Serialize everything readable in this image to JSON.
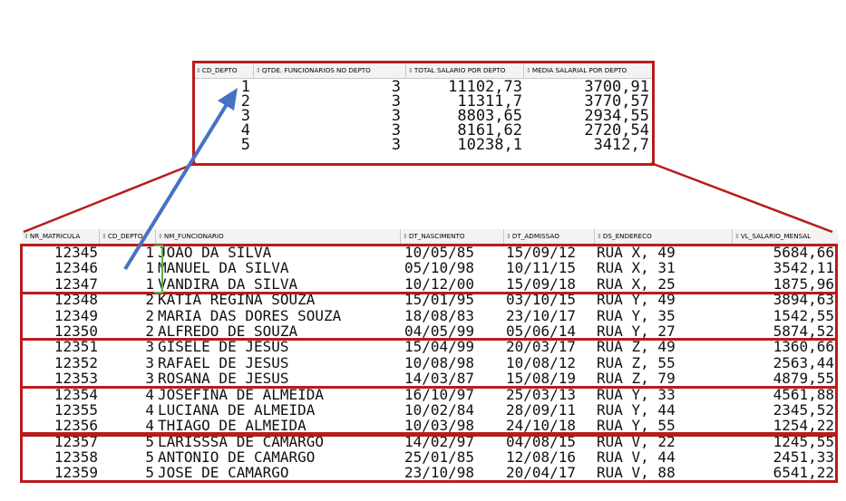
{
  "summary": {
    "headers": [
      "CD_DEPTO",
      "QTDE. FUNCIONARIOS NO DEPTO",
      "TOTAL SALARIO POR DEPTO",
      "MEDIA SALARIAL POR DEPTO"
    ],
    "rows": [
      [
        "1",
        "3",
        "11102,73",
        "3700,91"
      ],
      [
        "2",
        "3",
        "11311,7",
        "3770,57"
      ],
      [
        "3",
        "3",
        "8803,65",
        "2934,55"
      ],
      [
        "4",
        "3",
        "8161,62",
        "2720,54"
      ],
      [
        "5",
        "3",
        "10238,1",
        "3412,7"
      ]
    ]
  },
  "employees": {
    "headers": [
      "NR_MATRICULA",
      "CD_DEPTO",
      "NM_FUNCIONARIO",
      "DT_NASCIMENTO",
      "DT_ADMISSAO",
      "DS_ENDERECO",
      "VL_SALARIO_MENSAL"
    ],
    "rows": [
      [
        "12345",
        "1",
        "JOAO DA SILVA",
        "10/05/85",
        "15/09/12",
        "RUA X, 49",
        "5684,66"
      ],
      [
        "12346",
        "1",
        "MANUEL DA SILVA",
        "05/10/98",
        "10/11/15",
        "RUA X, 31",
        "3542,11"
      ],
      [
        "12347",
        "1",
        "VANDIRA DA SILVA",
        "10/12/00",
        "15/09/18",
        "RUA X, 25",
        "1875,96"
      ],
      [
        "12348",
        "2",
        "KATIA REGINA SOUZA",
        "15/01/95",
        "03/10/15",
        "RUA Y, 49",
        "3894,63"
      ],
      [
        "12349",
        "2",
        "MARIA DAS DORES SOUZA",
        "18/08/83",
        "23/10/17",
        "RUA Y, 35",
        "1542,55"
      ],
      [
        "12350",
        "2",
        "ALFREDO DE SOUZA",
        "04/05/99",
        "05/06/14",
        "RUA Y, 27",
        "5874,52"
      ],
      [
        "12351",
        "3",
        "GISELE DE JESUS",
        "15/04/99",
        "20/03/17",
        "RUA Z, 49",
        "1360,66"
      ],
      [
        "12352",
        "3",
        "RAFAEL DE JESUS",
        "10/08/98",
        "10/08/12",
        "RUA Z, 55",
        "2563,44"
      ],
      [
        "12353",
        "3",
        "ROSANA DE JESUS",
        "14/03/87",
        "15/08/19",
        "RUA Z, 79",
        "4879,55"
      ],
      [
        "12354",
        "4",
        "JOSEFINA DE ALMEIDA",
        "16/10/97",
        "25/03/13",
        "RUA Y, 33",
        "4561,88"
      ],
      [
        "12355",
        "4",
        "LUCIANA DE ALMEIDA",
        "10/02/84",
        "28/09/11",
        "RUA Y, 44",
        "2345,52"
      ],
      [
        "12356",
        "4",
        "THIAGO DE ALMEIDA",
        "10/03/98",
        "24/10/18",
        "RUA Y, 55",
        "1254,22"
      ],
      [
        "12357",
        "5",
        "LARISSSA DE CAMARGO",
        "14/02/97",
        "04/08/15",
        "RUA V, 22",
        "1245,55"
      ],
      [
        "12358",
        "5",
        "ANTONIO DE CAMARGO",
        "25/01/85",
        "12/08/16",
        "RUA V, 44",
        "2451,33"
      ],
      [
        "12359",
        "5",
        "JOSE DE CAMARGO",
        "23/10/98",
        "20/04/17",
        "RUA V, 88",
        "6541,22"
      ]
    ]
  },
  "colors": {
    "highlight_box": "#b71c1c",
    "arrow": "#4472c4",
    "bracket": "#5cb04a",
    "header_bg": "#f3f3f3"
  },
  "icons": {
    "column_sort": "sort-icon"
  }
}
